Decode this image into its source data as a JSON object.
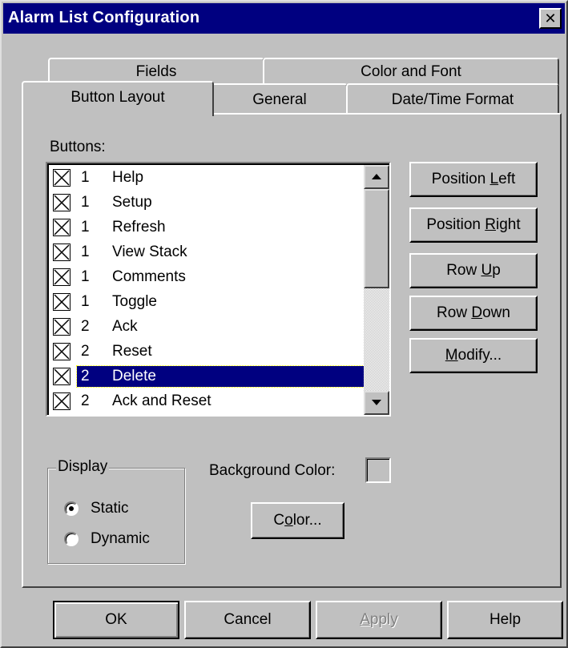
{
  "window": {
    "title": "Alarm List Configuration",
    "close_label": "✕"
  },
  "tabs": {
    "back": [
      "Fields",
      "Color and Font"
    ],
    "front": [
      "Button Layout",
      "General",
      "Date/Time Format"
    ],
    "active": "Button Layout"
  },
  "buttons_label": "Buttons:",
  "list": [
    {
      "row": "1",
      "name": "Help",
      "checked": true
    },
    {
      "row": "1",
      "name": "Setup",
      "checked": true
    },
    {
      "row": "1",
      "name": "Refresh",
      "checked": true
    },
    {
      "row": "1",
      "name": "View Stack",
      "checked": true
    },
    {
      "row": "1",
      "name": "Comments",
      "checked": true
    },
    {
      "row": "1",
      "name": "Toggle",
      "checked": true
    },
    {
      "row": "2",
      "name": "Ack",
      "checked": true
    },
    {
      "row": "2",
      "name": "Reset",
      "checked": true
    },
    {
      "row": "2",
      "name": "Delete",
      "checked": true,
      "selected": true
    },
    {
      "row": "2",
      "name": "Ack and Reset",
      "checked": true
    }
  ],
  "side_buttons": {
    "position_left": {
      "before": "Position ",
      "u": "L",
      "after": "eft"
    },
    "position_right": {
      "before": "Position ",
      "u": "R",
      "after": "ight"
    },
    "row_up": {
      "before": "Row ",
      "u": "U",
      "after": "p"
    },
    "row_down": {
      "before": "Row ",
      "u": "D",
      "after": "own"
    },
    "modify": {
      "before": "",
      "u": "M",
      "after": "odify..."
    }
  },
  "display": {
    "title": "Display",
    "options": [
      "Static",
      "Dynamic"
    ],
    "selected": "Static"
  },
  "background_color_label": "Background Color:",
  "color_button": {
    "before": "C",
    "u": "o",
    "after": "lor..."
  },
  "footer": {
    "ok": "OK",
    "cancel": "Cancel",
    "apply": {
      "before": "",
      "u": "A",
      "after": "pply"
    },
    "help": "Help"
  }
}
